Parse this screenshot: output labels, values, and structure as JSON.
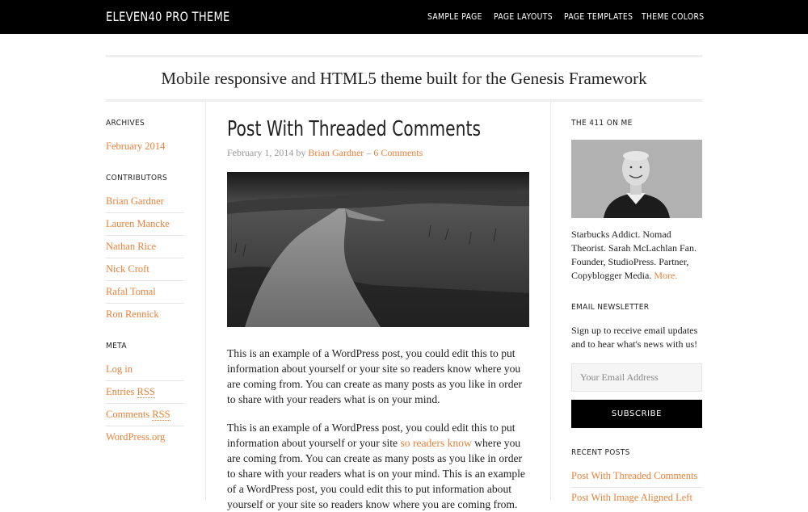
{
  "site": {
    "title": "ELEVEN40 PRO THEME",
    "description": "Mobile responsive and HTML5 theme built for the Genesis Framework"
  },
  "nav": [
    "SAMPLE PAGE",
    "PAGE LAYOUTS",
    "PAGE TEMPLATES",
    "THEME COLORS"
  ],
  "sidebar_left": {
    "archives": {
      "title": "ARCHIVES",
      "items": [
        "February 2014"
      ]
    },
    "contributors": {
      "title": "CONTRIBUTORS",
      "items": [
        "Brian Gardner",
        "Lauren Mancke",
        "Nathan Rice",
        "Nick Croft",
        "Rafal Tomal",
        "Ron Rennick"
      ]
    },
    "meta": {
      "title": "META",
      "items": [
        "Log in",
        "Entries",
        "Comments",
        "WordPress.org"
      ],
      "rss": "RSS"
    }
  },
  "post": {
    "title": "Post With Threaded Comments",
    "date": "February 1, 2014",
    "by": "by",
    "author": "Brian Gardner",
    "dash": "–",
    "comments": "6 Comments",
    "paragraph1": "This is an example of a WordPress post, you could edit this to put information about yourself or your site so readers know where you are coming from. You can create as many posts as you like in order to share with your readers what is on your mind.",
    "paragraph2_before": "This is an example of a WordPress post, you could edit this to put information about yourself or your site ",
    "paragraph2_link": "so readers know",
    "paragraph2_after": " where you are coming from. You can create as many posts as you like in order to share with your readers what is on your mind. This is an example of a WordPress post, you could edit this to put information about yourself or your site so readers know where you are coming from."
  },
  "sidebar_right": {
    "about": {
      "title": "THE 411 ON ME",
      "bio": "Starbucks Addict. Nomad Theorist. Sarah McLachlan Fan. Founder, StudioPress. Partner, Copyblogger Media.",
      "more": "More."
    },
    "newsletter": {
      "title": "EMAIL NEWSLETTER",
      "text": "Sign up to receive email updates and to hear what's news with us!",
      "placeholder": "Your Email Address",
      "button": "SUBSCRIBE"
    },
    "recent": {
      "title": "RECENT POSTS",
      "items": [
        "Post With Threaded Comments",
        "Post With Image Aligned Left"
      ]
    }
  },
  "colors": {
    "accent": "#e8813a",
    "header_bg": "#000000",
    "text": "#222222",
    "muted": "#999999"
  }
}
